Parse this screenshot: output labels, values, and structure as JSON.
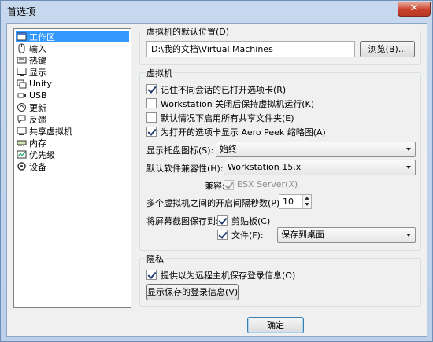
{
  "window": {
    "title": "首选项",
    "close_symbol": "✕"
  },
  "sidebar": {
    "items": [
      {
        "label": "工作区",
        "icon": "workspace-icon",
        "selected": true
      },
      {
        "label": "输入",
        "icon": "mouse-icon"
      },
      {
        "label": "热键",
        "icon": "keyboard-icon"
      },
      {
        "label": "显示",
        "icon": "monitor-icon"
      },
      {
        "label": "Unity",
        "icon": "unity-icon"
      },
      {
        "label": "USB",
        "icon": "usb-icon"
      },
      {
        "label": "更新",
        "icon": "update-icon"
      },
      {
        "label": "反馈",
        "icon": "feedback-icon"
      },
      {
        "label": "共享虚拟机",
        "icon": "shared-vm-icon"
      },
      {
        "label": "内存",
        "icon": "memory-icon"
      },
      {
        "label": "优先级",
        "icon": "priority-icon"
      },
      {
        "label": "设备",
        "icon": "device-icon"
      }
    ]
  },
  "default_location": {
    "label": "虚拟机的默认位置(D)",
    "path": "D:\\我的文档\\Virtual Machines",
    "browse_label": "浏览(B)..."
  },
  "vm": {
    "title": "虚拟机",
    "checkboxes": [
      {
        "label": "记住不同会话的已打开选项卡(R)",
        "checked": true
      },
      {
        "label": "Workstation 关闭后保持虚拟机运行(K)",
        "checked": false
      },
      {
        "label": "默认情况下启用所有共享文件夹(E)",
        "checked": false
      },
      {
        "label": "为打开的选项卡显示 Aero Peek 缩略图(A)",
        "checked": true
      }
    ],
    "tray_icon_label": "显示托盘图标(S):",
    "tray_icon_value": "始终",
    "compat_label": "默认软件兼容性(H):",
    "compat_value": "Workstation 15.x",
    "compat_with_label": "兼容:",
    "esx_label": "ESX Server(X)",
    "esx_checked": true,
    "interval_label": "多个虚拟机之间的开启间隔秒数(P):",
    "interval_value": "10",
    "save_screenshot_label": "将屏幕截图保存到:",
    "clipboard_label": "剪贴板(C)",
    "clipboard_checked": true,
    "file_label": "文件(F):",
    "file_checked": true,
    "file_target": "保存到桌面"
  },
  "privacy": {
    "title": "隐私",
    "save_login_label": "提供以为远程主机保存登录信息(O)",
    "save_login_checked": true,
    "show_login_button": "显示保存的登录信息(V)"
  },
  "footer": {
    "ok_label": "确定"
  },
  "colors": {
    "selection": "#3399ff",
    "title_bar": "#c7d8ee",
    "close": "#c7412b"
  }
}
